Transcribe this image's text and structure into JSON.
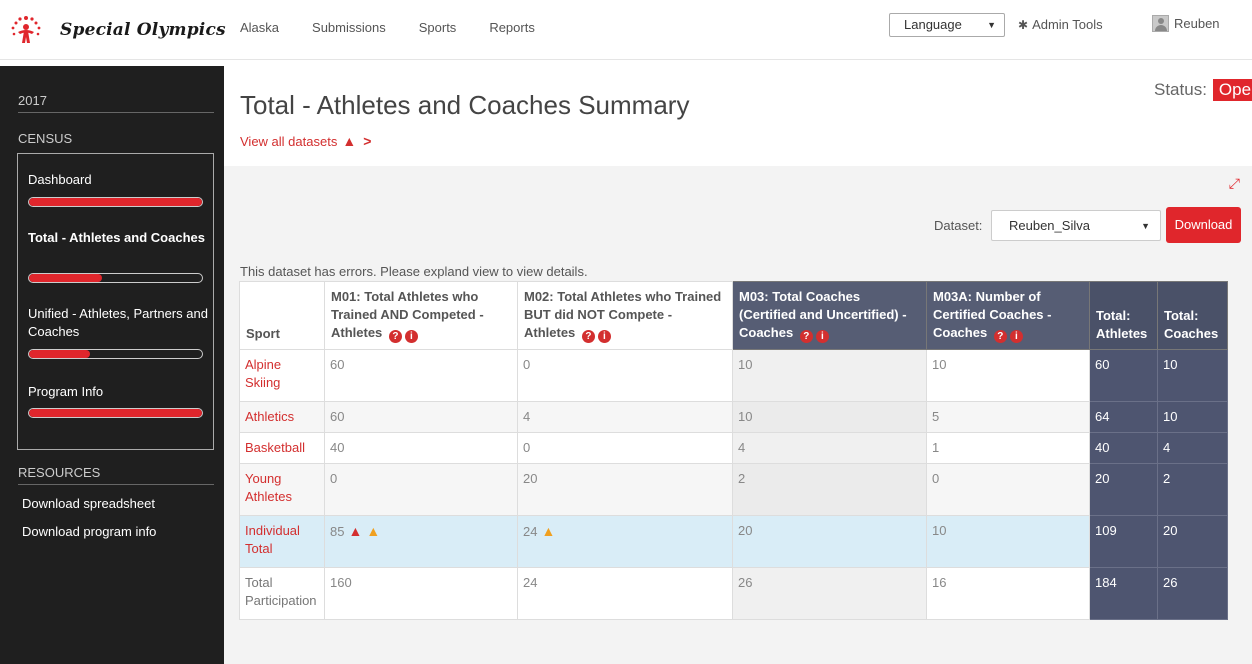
{
  "brand": {
    "name": "Special Olympics"
  },
  "nav": {
    "items": [
      "Alaska",
      "Submissions",
      "Sports",
      "Reports"
    ]
  },
  "header": {
    "language": "Language",
    "admin_tools": "Admin Tools",
    "user": "Reuben"
  },
  "sidebar": {
    "year": "2017",
    "section": "CENSUS",
    "items": [
      {
        "label": "Dashboard",
        "progress": 1.0
      },
      {
        "label": "Total - Athletes and Coaches",
        "progress": 0.42
      },
      {
        "label": "Unified - Athletes, Partners and Coaches",
        "progress": 0.35
      },
      {
        "label": "Program Info",
        "progress": 1.0
      }
    ],
    "resources_title": "RESOURCES",
    "resources": [
      "Download spreadsheet",
      "Download program info"
    ]
  },
  "main": {
    "title": "Total - Athletes and Coaches Summary",
    "view_all": "View all datasets",
    "status_label": "Status:",
    "status_value": "Open",
    "dataset_label": "Dataset:",
    "dataset_value": "Reuben_Silva",
    "download": "Download",
    "error_note": "This dataset has errors. Please expland view to view details."
  },
  "table": {
    "headers": [
      "Sport",
      "M01: Total Athletes who Trained AND Competed - Athletes",
      "M02: Total Athletes who Trained BUT did NOT Compete - Athletes",
      "M03: Total Coaches (Certified and Uncertified) - Coaches",
      "M03A: Number of Certified Coaches - Coaches",
      "Total: Athletes",
      "Total: Coaches"
    ],
    "rows": [
      [
        "Alpine Skiing",
        "60",
        "0",
        "10",
        "10",
        "60",
        "10"
      ],
      [
        "Athletics",
        "60",
        "4",
        "10",
        "5",
        "64",
        "10"
      ],
      [
        "Basketball",
        "40",
        "0",
        "4",
        "1",
        "40",
        "4"
      ],
      [
        "Young Athletes",
        "0",
        "20",
        "2",
        "0",
        "20",
        "2"
      ],
      [
        "Individual Total",
        "85",
        "24",
        "20",
        "10",
        "109",
        "20"
      ],
      [
        "Total Participation",
        "160",
        "24",
        "26",
        "16",
        "184",
        "26"
      ]
    ]
  }
}
